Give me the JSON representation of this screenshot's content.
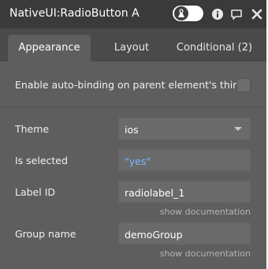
{
  "window": {
    "title": "NativeUI:RadioButton A"
  },
  "header_icons": [
    "element-toggle-icon",
    "info-icon",
    "comment-icon",
    "close-icon"
  ],
  "tabs": [
    {
      "label": "Appearance",
      "active": true
    },
    {
      "label": "Layout",
      "active": false
    },
    {
      "label": "Conditional (2)",
      "active": false
    }
  ],
  "autobind": {
    "label": "Enable auto-binding on parent element's thing",
    "checked": false
  },
  "fields": {
    "theme": {
      "label": "Theme",
      "value": "ios"
    },
    "is_selected": {
      "label": "Is selected",
      "value": "\"yes\""
    },
    "label_id": {
      "label": "Label ID",
      "value": "radiolabel_1",
      "doc_link": "show documentation"
    },
    "group_name": {
      "label": "Group name",
      "value": "demoGroup",
      "doc_link": "show documentation"
    }
  },
  "colors": {
    "header": "#3a3a3a",
    "panel": "#5e5e5e",
    "field": "#6a6a6a",
    "dynamic_value": "#7eb6ff"
  }
}
